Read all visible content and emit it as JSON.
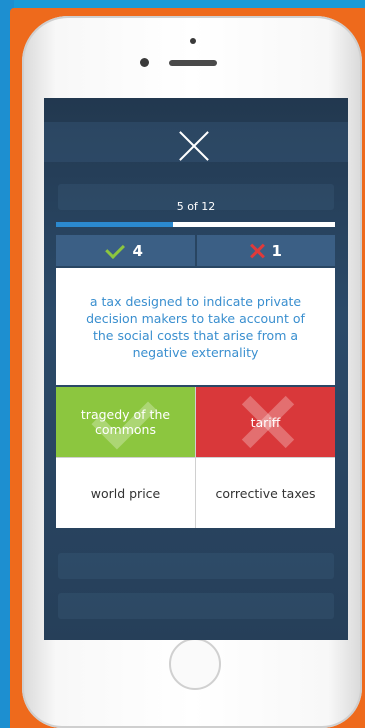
{
  "quiz": {
    "progress_text": "5 of 12",
    "progress_fraction": 0.42,
    "correct_count": "4",
    "wrong_count": "1",
    "question": "a tax designed to indicate private decision makers to take account of the social costs that arise from a negative externality",
    "answers": [
      {
        "label": "tragedy of the commons",
        "state": "correct"
      },
      {
        "label": "tariff",
        "state": "wrong"
      },
      {
        "label": "world price",
        "state": "neutral"
      },
      {
        "label": "corrective taxes",
        "state": "neutral"
      }
    ]
  },
  "colors": {
    "correct": "#8cc63f",
    "wrong": "#d9383a",
    "accent": "#3a8fcf",
    "score_bg": "#3b5f85",
    "frame_orange": "#ee6a1c",
    "background_blue": "#1a9ad6"
  },
  "icons": {
    "close": "close-icon",
    "correct": "check-icon",
    "wrong": "x-icon"
  }
}
